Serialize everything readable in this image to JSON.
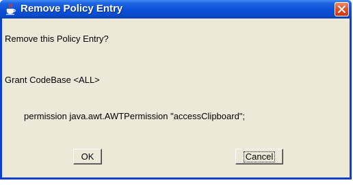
{
  "window": {
    "title": "Remove Policy Entry",
    "app_icon": "java-cup-icon",
    "close_icon": "close-icon"
  },
  "dialog": {
    "question": "Remove this Policy Entry?",
    "grant": "Grant CodeBase <ALL>",
    "permission": "permission java.awt.AWTPermission \"accessClipboard\";"
  },
  "buttons": {
    "ok": "OK",
    "cancel": "Cancel"
  },
  "colors": {
    "titlebar": "#0b4fd7",
    "close_button": "#e0522b",
    "dialog_background": "#ece9d8"
  }
}
